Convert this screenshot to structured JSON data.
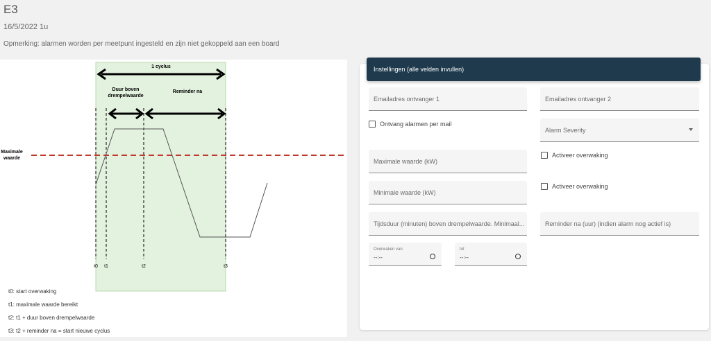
{
  "page": {
    "title": "E3",
    "date": "16/5/2022 1u",
    "remark": "Opmerking: alarmen worden per meetpunt ingesteld en zijn niet gekoppeld aan een board"
  },
  "diagram": {
    "cycle_label": "1 cyclus",
    "duration_label_line1": "Duur boven",
    "duration_label_line2": "drempelwaarde",
    "reminder_label": "Reminder na",
    "max_label_line1": "Maximale",
    "max_label_line2": "waarde",
    "t_labels": [
      "t0",
      "t1",
      "t2",
      "t3"
    ],
    "legend": [
      "t0: start overwaking",
      "t1: maximale waarde bereikt",
      "t2: t1 + duur boven drempelwaarde",
      "t3: t2 + reminder na = start nieuwe cyclus"
    ],
    "colors": {
      "threshold": "#c0392b",
      "cycle_region": "#e3f1df"
    }
  },
  "settings": {
    "header": "Instellingen (alle velden invullen)",
    "email1": "Emailadres ontvanger 1",
    "email2": "Emailadres ontvanger 2",
    "receive_alarms": "Ontvang alarmen per mail",
    "severity": "Alarm Severity",
    "max_value": "Maximale waarde (kW)",
    "activate1": "Activeer overwaking",
    "min_value": "Minimale waarde (kW)",
    "activate2": "Activeer overwaking",
    "duration": "Tijdsduur (minuten) boven drempelwaarde. Minimaal...",
    "reminder": "Reminder na (uur) (indien alarm nog actief is)",
    "watch_from_label": "Overwaken van",
    "watch_from_value": "--:--",
    "watch_to_label": "tot",
    "watch_to_value": "--:--",
    "colors": {
      "header_bg": "#1e3a4c"
    }
  }
}
